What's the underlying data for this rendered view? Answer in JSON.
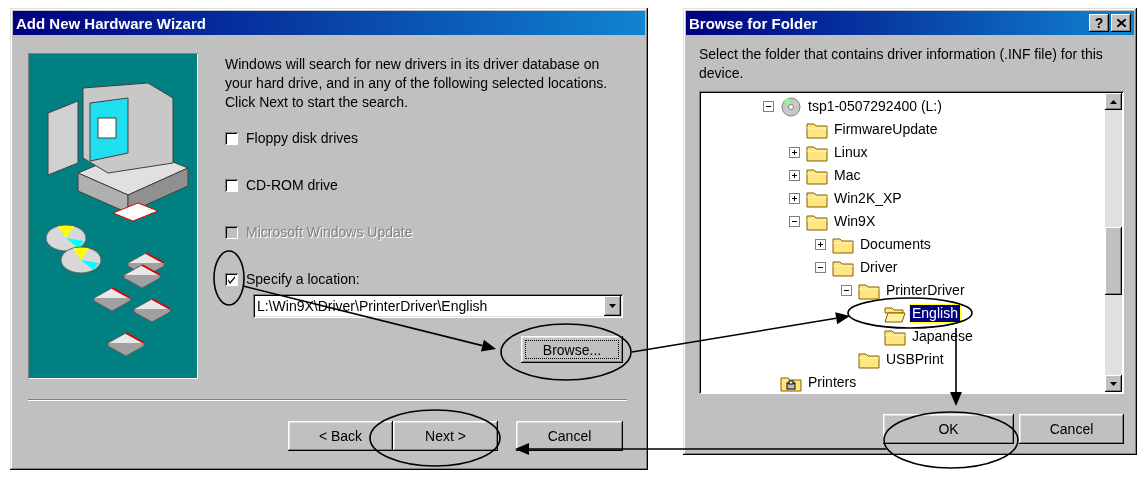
{
  "wizard": {
    "title": "Add New Hardware Wizard",
    "intro": "Windows will search for new drivers in its driver database on your hard drive, and in any of the following selected locations. Click Next to start the search.",
    "options": [
      {
        "label": "Floppy disk drives",
        "checked": false,
        "disabled": false
      },
      {
        "label": "CD-ROM drive",
        "checked": false,
        "disabled": false
      },
      {
        "label": "Microsoft Windows Update",
        "checked": false,
        "disabled": true
      },
      {
        "label": "Specify a location:",
        "checked": true,
        "disabled": false
      }
    ],
    "location": {
      "value": "L:\\Win9X\\Driver\\PrinterDriver\\English"
    },
    "browse_button": {
      "label": "Browse...",
      "focused": true
    },
    "buttons": [
      {
        "label": "< Back"
      },
      {
        "label": "Next >"
      },
      {
        "label": "Cancel"
      }
    ]
  },
  "browse_dialog": {
    "title": "Browse for Folder",
    "help_button": "?",
    "description": "Select the folder that contains driver information (.INF file) for this device.",
    "tree": [
      {
        "label": "tsp1-0507292400 (L:)",
        "kind": "drive",
        "expanded": true,
        "selected": false,
        "children": [
          {
            "label": "FirmwareUpdate",
            "kind": "folder",
            "selected": false
          },
          {
            "label": "Linux",
            "kind": "folder",
            "expanded": false,
            "selected": false
          },
          {
            "label": "Mac",
            "kind": "folder",
            "expanded": false,
            "selected": false
          },
          {
            "label": "Win2K_XP",
            "kind": "folder",
            "expanded": false,
            "selected": false
          },
          {
            "label": "Win9X",
            "kind": "folder",
            "expanded": true,
            "selected": false,
            "children": [
              {
                "label": "Documents",
                "kind": "folder",
                "expanded": false,
                "selected": false
              },
              {
                "label": "Driver",
                "kind": "folder",
                "expanded": true,
                "selected": false,
                "children": [
                  {
                    "label": "PrinterDriver",
                    "kind": "folder",
                    "expanded": true,
                    "selected": false,
                    "children": [
                      {
                        "label": "English",
                        "kind": "folder",
                        "selected": true
                      },
                      {
                        "label": "Japanese",
                        "kind": "folder",
                        "selected": false
                      }
                    ]
                  },
                  {
                    "label": "USBPrint",
                    "kind": "folder",
                    "selected": false
                  }
                ]
              }
            ]
          }
        ]
      },
      {
        "label": "Printers",
        "kind": "printers",
        "selected": false
      }
    ],
    "buttons": [
      {
        "label": "OK"
      },
      {
        "label": "Cancel"
      }
    ]
  }
}
